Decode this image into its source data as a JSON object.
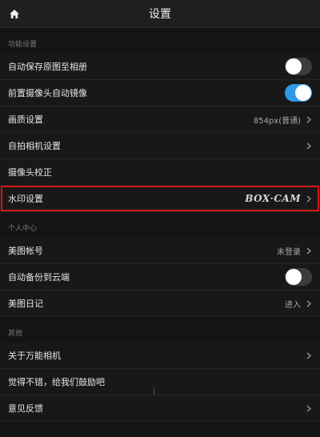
{
  "header": {
    "title": "设置",
    "home_icon": "home-icon"
  },
  "sections": {
    "function": {
      "title": "功能设置",
      "rows": [
        {
          "label": "自动保存原图至相册",
          "toggle": false
        },
        {
          "label": "前置摄像头自动镜像",
          "toggle": true
        },
        {
          "label": "画质设置",
          "value": "854px(普通)"
        },
        {
          "label": "自拍相机设置"
        },
        {
          "label": "摄像头校正"
        },
        {
          "label": "水印设置",
          "watermark": "BOX·CAM"
        }
      ]
    },
    "personal": {
      "title": "个人中心",
      "rows": [
        {
          "label": "美图帐号",
          "value": "未登录"
        },
        {
          "label": "自动备份到云端",
          "toggle": false
        },
        {
          "label": "美图日记",
          "value": "进入"
        }
      ]
    },
    "other": {
      "title": "其他",
      "rows": [
        {
          "label": "关于万能相机"
        },
        {
          "label": "觉得不错，给我们鼓励吧"
        },
        {
          "label": "意见反馈"
        }
      ]
    }
  },
  "colors": {
    "accent": "#2f9be5",
    "highlight": "#d4161a",
    "background": "#141414"
  }
}
